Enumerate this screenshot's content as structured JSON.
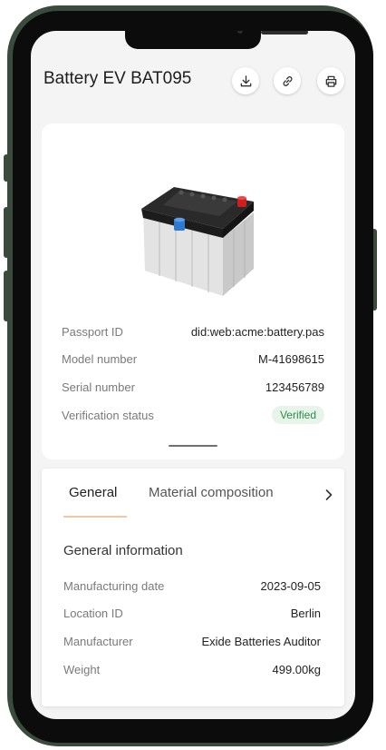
{
  "header": {
    "title": "Battery EV BAT095",
    "icons": [
      "download-icon",
      "link-icon",
      "printer-icon"
    ]
  },
  "passport": {
    "rows": [
      {
        "label": "Passport ID",
        "value": "did:web:acme:battery.pas"
      },
      {
        "label": "Model number",
        "value": "M-41698615"
      },
      {
        "label": "Serial number",
        "value": "123456789"
      },
      {
        "label": "Verification status",
        "value": "Verified"
      }
    ]
  },
  "tabs": [
    {
      "label": "General",
      "active": true
    },
    {
      "label": "Material composition",
      "active": false
    }
  ],
  "general": {
    "section_title": "General information",
    "rows": [
      {
        "label": "Manufacturing date",
        "value": "2023-09-05"
      },
      {
        "label": "Location ID",
        "value": "Berlin"
      },
      {
        "label": "Manufacturer",
        "value": "Exide Batteries Auditor"
      },
      {
        "label": "Weight",
        "value": "499.00kg"
      }
    ]
  },
  "colors": {
    "verified_bg": "#e6f4ea",
    "verified_text": "#2f8a4f",
    "tab_underline": "#f3c7a3"
  }
}
